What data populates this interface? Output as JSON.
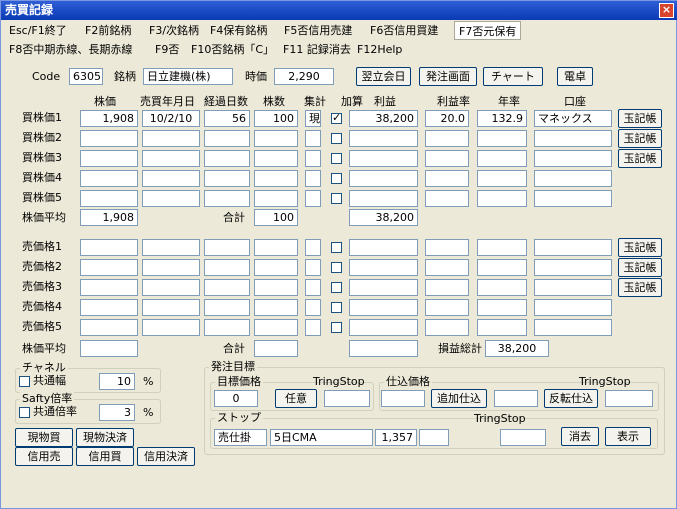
{
  "window": {
    "title": "売買記録",
    "close": "×"
  },
  "menu1": [
    "Esc/F1終了",
    "F2前銘柄",
    "F3/次銘柄",
    "F4保有銘柄",
    "F5否信用売建",
    "F6否信用買建",
    "F7否元保有"
  ],
  "menu2": [
    "F8否中期赤線、長期赤線",
    "F9否",
    "F10否銘柄「C」",
    "F11 記録消去",
    "F12Help"
  ],
  "top": {
    "code_label": "Code",
    "code_value": "6305",
    "name_label": "銘柄",
    "name_value": "日立建機(株)",
    "price_label": "時価",
    "price_value": "2,290",
    "btn_next_day": "翌立会日",
    "btn_order": "発注画面",
    "btn_chart": "チャート",
    "btn_calc": "電卓"
  },
  "headers": {
    "price": "株価",
    "date": "売買年月日",
    "days": "経過日数",
    "shares": "株数",
    "sum": "集計",
    "add": "加算",
    "profit": "利益",
    "rate": "利益率",
    "annual": "年率",
    "account": "口座"
  },
  "buy_rows": [
    {
      "label": "買株価1",
      "price": "1,908",
      "date": "10/2/10",
      "days": "56",
      "shares": "100",
      "sum": "現",
      "checked": true,
      "profit": "38,200",
      "rate": "20.0",
      "annual": "132.9",
      "account": "マネックス",
      "btn": "玉記帳"
    },
    {
      "label": "買株価2",
      "price": "",
      "date": "",
      "days": "",
      "shares": "",
      "sum": "",
      "checked": false,
      "profit": "",
      "rate": "",
      "annual": "",
      "account": "",
      "btn": "玉記帳"
    },
    {
      "label": "買株価3",
      "price": "",
      "date": "",
      "days": "",
      "shares": "",
      "sum": "",
      "checked": false,
      "profit": "",
      "rate": "",
      "annual": "",
      "account": "",
      "btn": "玉記帳"
    },
    {
      "label": "買株価4",
      "price": "",
      "date": "",
      "days": "",
      "shares": "",
      "sum": "",
      "checked": false,
      "profit": "",
      "rate": "",
      "annual": "",
      "account": "",
      "btn": ""
    },
    {
      "label": "買株価5",
      "price": "",
      "date": "",
      "days": "",
      "shares": "",
      "sum": "",
      "checked": false,
      "profit": "",
      "rate": "",
      "annual": "",
      "account": "",
      "btn": ""
    }
  ],
  "buy_avg": {
    "label": "株価平均",
    "value": "1,908",
    "total_label": "合計",
    "total": "100",
    "profit": "38,200"
  },
  "sell_rows": [
    {
      "label": "売価格1",
      "btn": "玉記帳"
    },
    {
      "label": "売価格2",
      "btn": "玉記帳"
    },
    {
      "label": "売価格3",
      "btn": "玉記帳"
    },
    {
      "label": "売価格4",
      "btn": ""
    },
    {
      "label": "売価格5",
      "btn": ""
    }
  ],
  "sell_avg": {
    "label": "株価平均",
    "total_label": "合計",
    "pl_label": "損益総計",
    "pl_value": "38,200"
  },
  "channel": {
    "title": "チャネル",
    "check_label": "共通幅",
    "value": "10",
    "unit": "%"
  },
  "safty": {
    "title": "Safty倍率",
    "check_label": "共通倍率",
    "value": "3",
    "unit": "%"
  },
  "trade_btns": [
    "現物買",
    "現物決済",
    "信用売",
    "信用買",
    "信用決済"
  ],
  "order": {
    "title": "発注目標",
    "target_title": "目標価格",
    "target_value": "0",
    "any_btn": "任意",
    "tring1": "TringStop",
    "buy_title": "仕込価格",
    "add_btn": "追加仕込",
    "rev_btn": "反転仕込",
    "tring2": "TringStop",
    "stop_title": "ストップ",
    "stop_type": "売仕掛",
    "stop_ind": "5日CMA",
    "stop_value": "1,357",
    "tring3": "TringStop",
    "cancel_btn": "消去",
    "show_btn": "表示"
  }
}
